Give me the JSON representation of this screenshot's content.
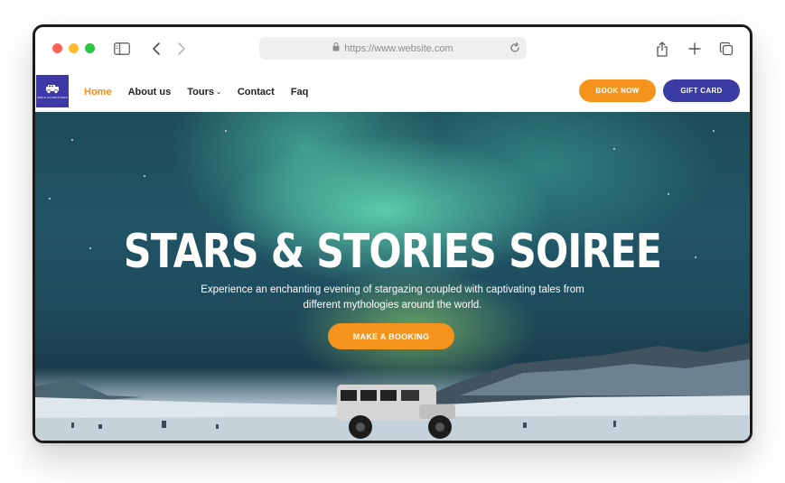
{
  "browser": {
    "url": "https://www.website.com",
    "traffic_lights": {
      "close": "#ff5f57",
      "minimize": "#febc2e",
      "maximize": "#28c840"
    }
  },
  "site": {
    "logo_text": "SMILE ADVENTURES",
    "nav": {
      "items": [
        {
          "label": "Home",
          "active": true
        },
        {
          "label": "About us",
          "active": false
        },
        {
          "label": "Tours",
          "active": false,
          "has_dropdown": true
        },
        {
          "label": "Contact",
          "active": false
        },
        {
          "label": "Faq",
          "active": false
        }
      ]
    },
    "buttons": {
      "book_now": "BOOK NOW",
      "gift_card": "GIFT CARD"
    },
    "colors": {
      "accent": "#f5941d",
      "brand": "#3b3ba4"
    }
  },
  "hero": {
    "title": "STARS & STORIES SOIREE",
    "subtitle": "Experience an enchanting evening of stargazing coupled with captivating tales from different mythologies around the world.",
    "cta": "MAKE A BOOKING"
  }
}
